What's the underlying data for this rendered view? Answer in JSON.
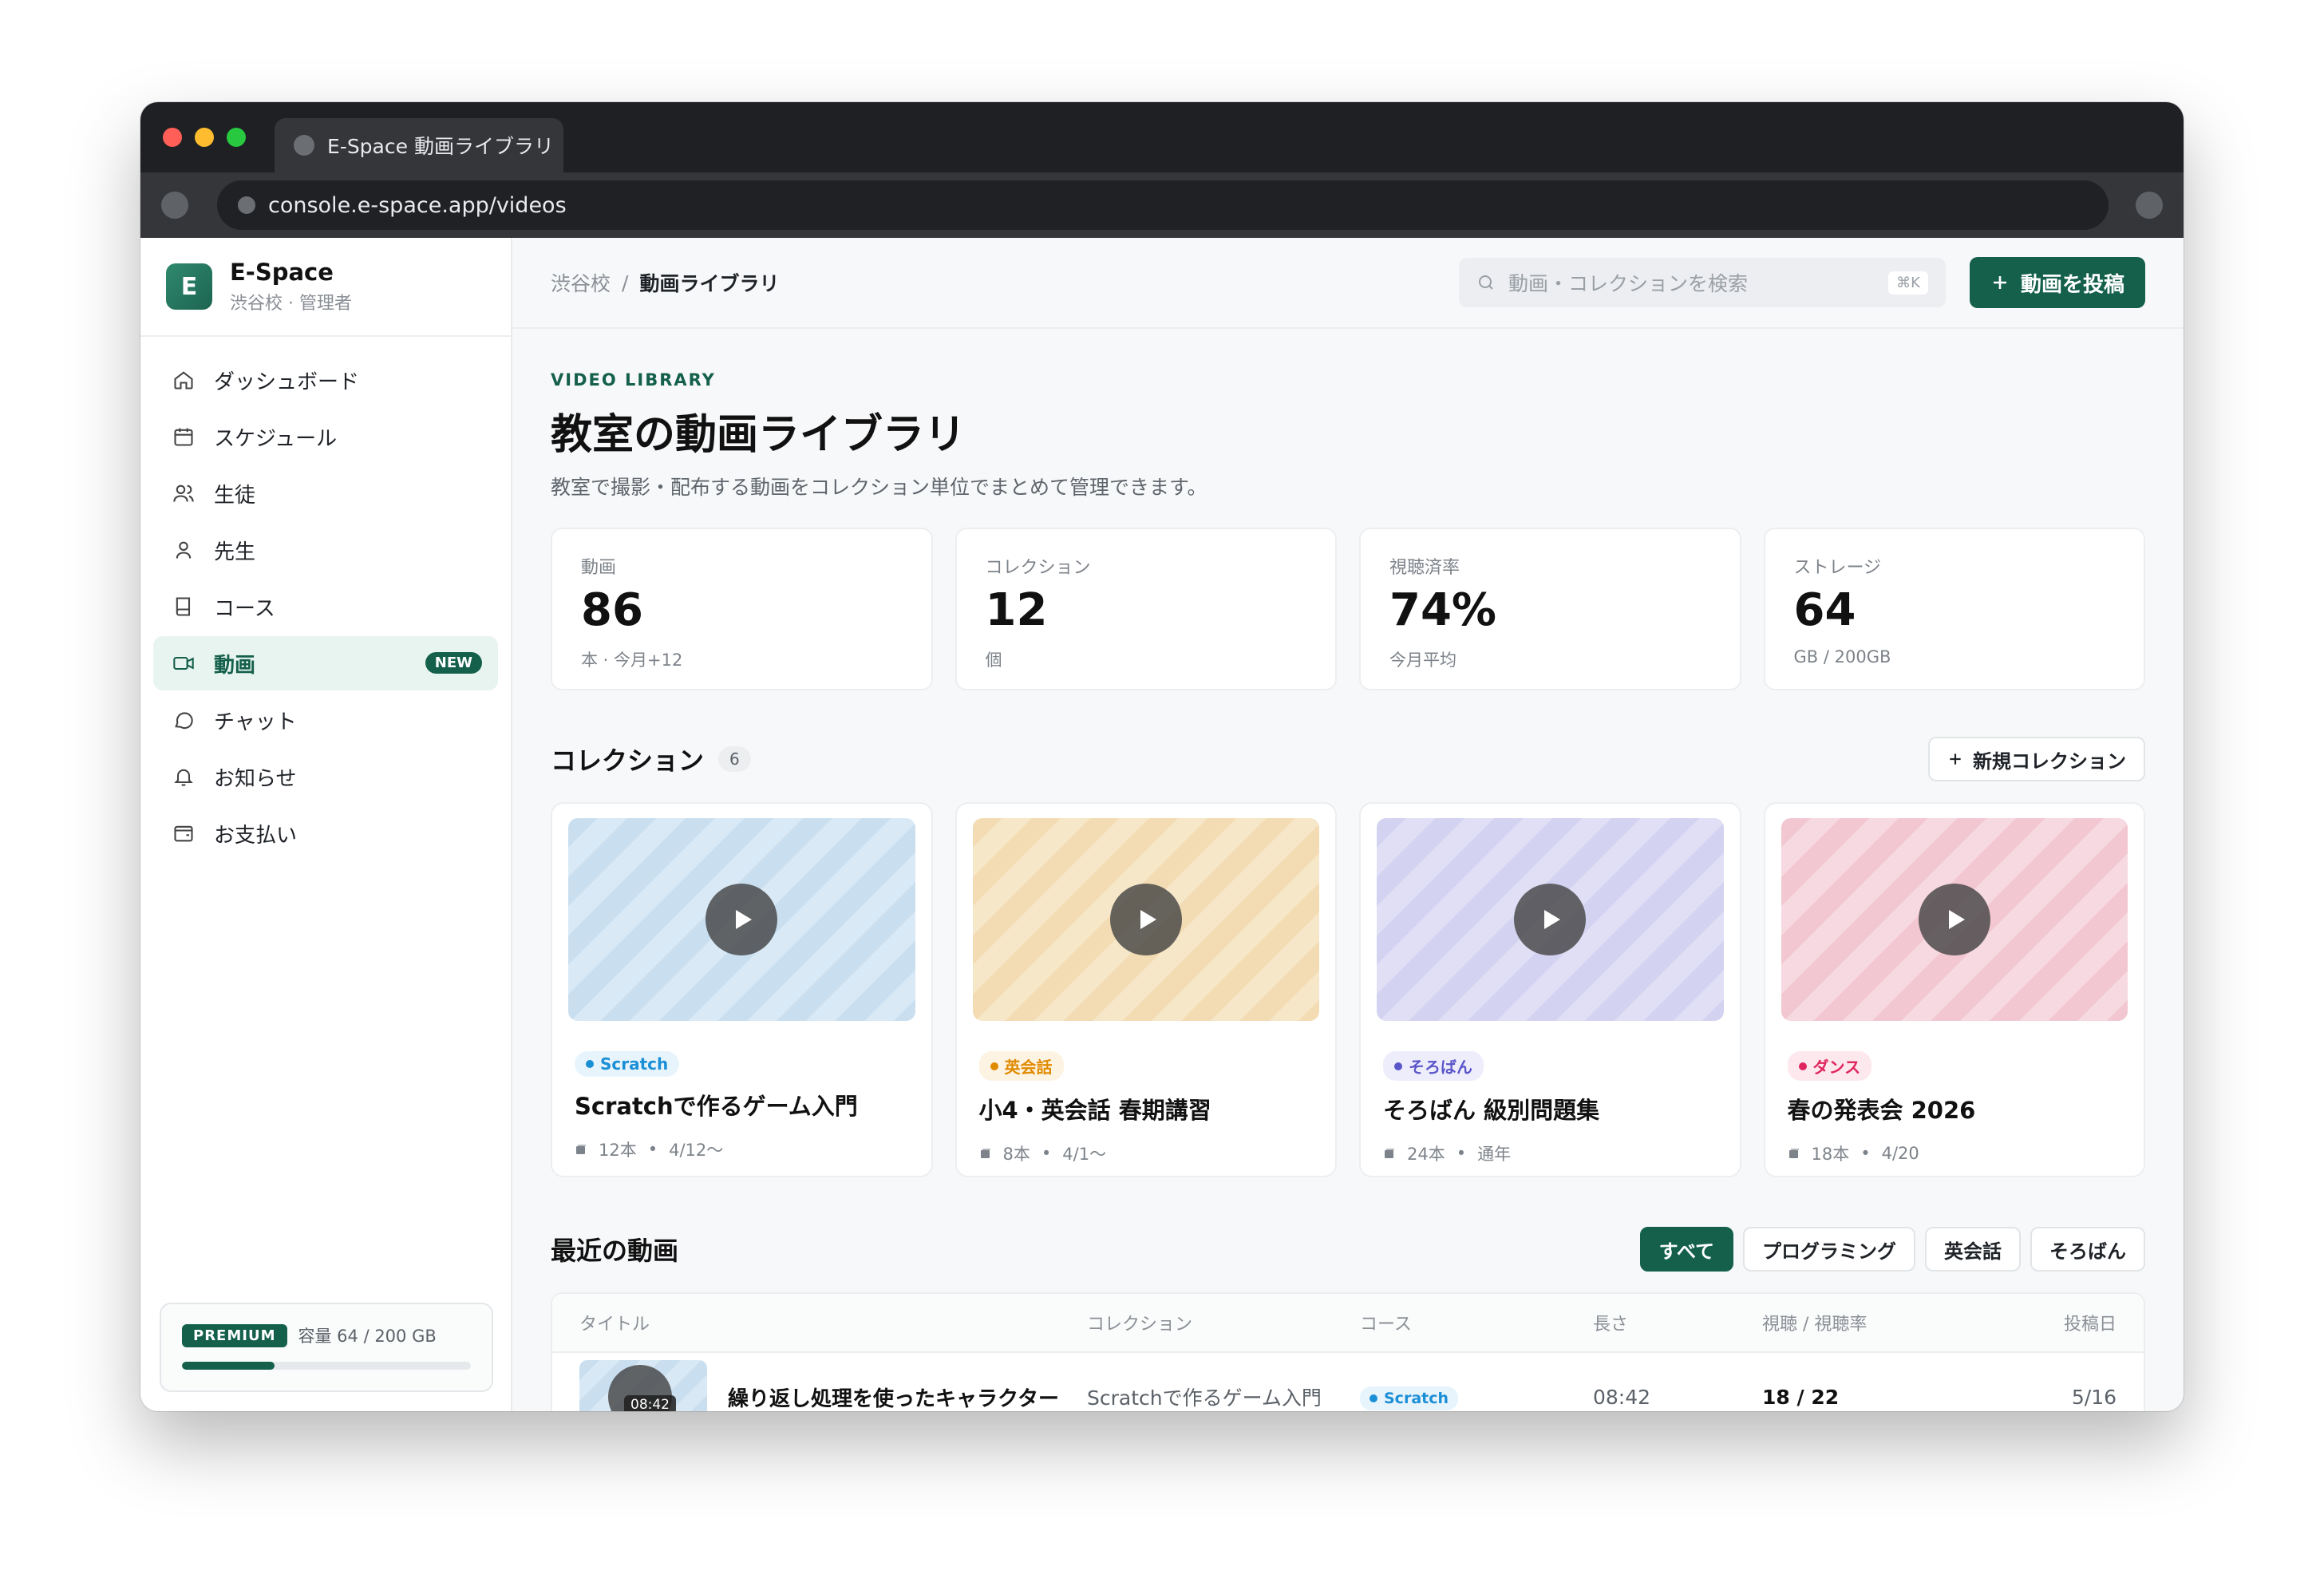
{
  "browser": {
    "tab_title": "E-Space 動画ライブラリ",
    "url": "console.e-space.app/videos"
  },
  "brand": {
    "logo": "E",
    "name": "E-Space",
    "sub": "渋谷校 · 管理者"
  },
  "nav": [
    {
      "label": "ダッシュボード",
      "icon": "home-icon"
    },
    {
      "label": "スケジュール",
      "icon": "calendar-icon"
    },
    {
      "label": "生徒",
      "icon": "users-icon"
    },
    {
      "label": "先生",
      "icon": "user-icon"
    },
    {
      "label": "コース",
      "icon": "book-icon"
    },
    {
      "label": "動画",
      "icon": "video-icon",
      "active": true,
      "badge": "NEW"
    },
    {
      "label": "チャット",
      "icon": "chat-icon"
    },
    {
      "label": "お知らせ",
      "icon": "bell-icon"
    },
    {
      "label": "お支払い",
      "icon": "wallet-icon"
    }
  ],
  "plan": {
    "badge": "PREMIUM",
    "usage_text": "容量 64 / 200 GB",
    "usage_fraction": 0.32
  },
  "topbar": {
    "breadcrumb_root": "渋谷校",
    "breadcrumb_sep": "/",
    "breadcrumb_current": "動画ライブラリ",
    "search_placeholder": "動画・コレクションを検索",
    "search_shortcut": "⌘K",
    "post_button": "動画を投稿"
  },
  "header": {
    "eyebrow": "VIDEO LIBRARY",
    "title": "教室の動画ライブラリ",
    "description": "教室で撮影・配布する動画をコレクション単位でまとめて管理できます。"
  },
  "stats": [
    {
      "label": "動画",
      "value": "86",
      "sub": "本 · 今月+12"
    },
    {
      "label": "コレクション",
      "value": "12",
      "sub": "個"
    },
    {
      "label": "視聴済率",
      "value": "74%",
      "sub": "今月平均"
    },
    {
      "label": "ストレージ",
      "value": "64",
      "sub": "GB / 200GB"
    }
  ],
  "collections_section": {
    "title": "コレクション",
    "count": "6",
    "new_button": "新規コレクション"
  },
  "collections": [
    {
      "tag": "Scratch",
      "tag_color": "#1a8fd6",
      "tag_bg": "#e8f4fc",
      "thumb_a": "#c9dff0",
      "thumb_b": "#d9e9f6",
      "title": "Scratchで作るゲーム入門",
      "count": "12本",
      "date": "4/12〜"
    },
    {
      "tag": "英会話",
      "tag_color": "#e08a00",
      "tag_bg": "#fdf3e2",
      "thumb_a": "#f3dcb3",
      "thumb_b": "#f7e7c9",
      "title": "小4・英会話 春期講習",
      "count": "8本",
      "date": "4/1〜"
    },
    {
      "tag": "そろばん",
      "tag_color": "#5a55c9",
      "tag_bg": "#eeedfb",
      "thumb_a": "#d3d2f0",
      "thumb_b": "#e0dff6",
      "title": "そろばん 級別問題集",
      "count": "24本",
      "date": "通年"
    },
    {
      "tag": "ダンス",
      "tag_color": "#e0245e",
      "tag_bg": "#fde8ee",
      "thumb_a": "#f2c7d2",
      "thumb_b": "#f7d9e1",
      "title": "春の発表会 2026",
      "count": "18本",
      "date": "4/20"
    }
  ],
  "recent_section": {
    "title": "最近の動画",
    "filters": [
      "すべて",
      "プログラミング",
      "英会話",
      "そろばん"
    ],
    "active_filter": "すべて"
  },
  "table": {
    "headers": [
      "タイトル",
      "コレクション",
      "コース",
      "長さ",
      "視聴 / 視聴率",
      "投稿日"
    ],
    "rows": [
      {
        "duration_badge": "08:42",
        "title": "繰り返し処理を使ったキャラクター",
        "collection": "Scratchで作るゲーム入門",
        "course": "Scratch",
        "length": "08:42",
        "views": "18 / 22",
        "date": "5/16"
      }
    ]
  },
  "colors": {
    "accent": "#14604b",
    "accent_light": "#e8f4f0"
  }
}
